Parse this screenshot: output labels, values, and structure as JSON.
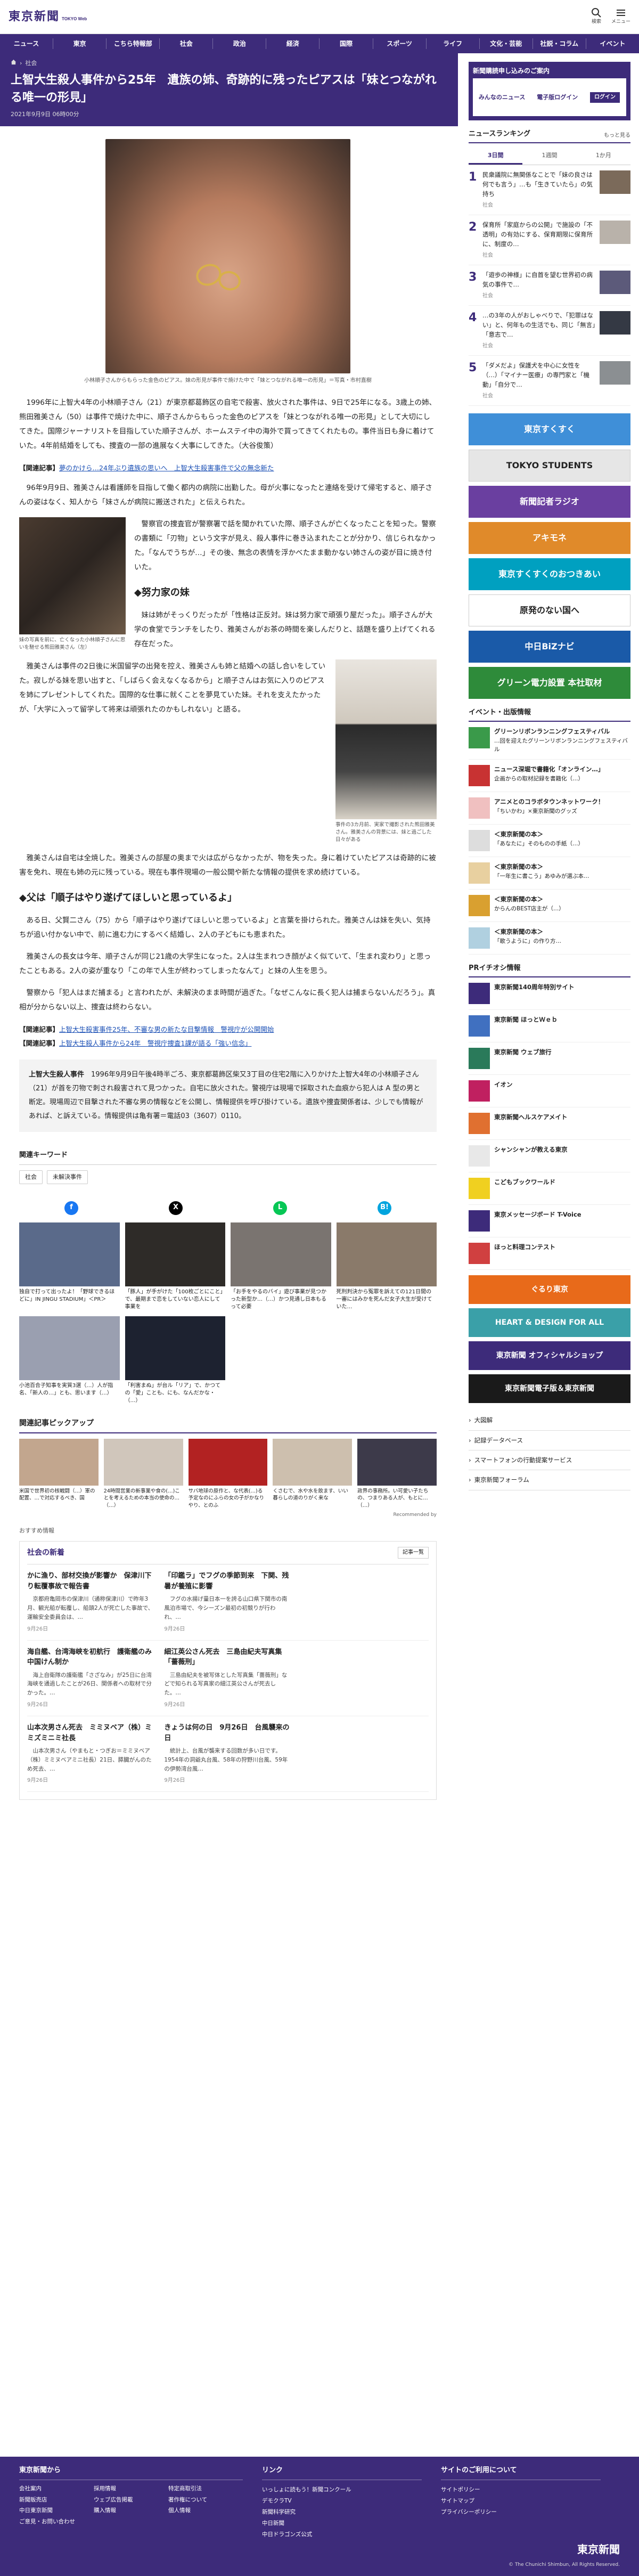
{
  "header": {
    "logo": "東京新聞",
    "logo_sub": "TOKYO Web",
    "icons": [
      {
        "name": "search-icon",
        "label": "検索"
      },
      {
        "name": "menu-icon",
        "label": "メニュー"
      }
    ]
  },
  "nav": [
    "ニュース",
    "東京",
    "こちら特報部",
    "社会",
    "政治",
    "経済",
    "国際",
    "スポーツ",
    "ライフ",
    "文化・芸能",
    "社説・コラム",
    "イベント"
  ],
  "article": {
    "breadcrumb": [
      "社会"
    ],
    "title": "上智大生殺人事件から25年　遺族の姉、奇跡的に残ったピアスは「妹とつながれる唯一の形見」",
    "date": "2021年9月9日 06時00分",
    "photo_caption": "小林順子さんからもらった金色のピアス。妹の形見が事件で焼けた中で「妹とつながれる唯一の形見」＝写真・市村直樹",
    "lead": "　1996年に上智大4年の小林順子さん（21）が東京都葛飾区の自宅で殺害、放火された事件は、9日で25年になる。3歳上の姉、熊田雅美さん（50）は事件で焼けた中に、順子さんからもらった金色のピアスを「妹とつながれる唯一の形見」として大切にしてきた。国際ジャーナリストを目指していた順子さんが、ホームステイ中の海外で買ってきてくれたもの。事件当日も身に着けていた。4年前結婚をしても、捜査の一部の進展なく大事にしてきた。（大谷俊策）",
    "related1_label": "【関連記事】",
    "related1_link": "夢のかけら…24年ぶり遺族の思いへ　上智大生殺害事件で父の無念新た",
    "p1": "　96年9月9日、雅美さんは看護師を目指して働く都内の病院に出勤した。母が火事になったと連絡を受けて帰宅すると、順子さんの姿はなく、知人から「妹さんが病院に搬送された」と伝えられた。",
    "p2": "　警察官の捜査官が警察署で話を聞かれていた際、順子さんが亡くなったことを知った。警察の書類に「刃物」という文字が見え、殺人事件に巻き込まれたことが分かり、信じられなかった。「なんでうちが…」その後、無念の表情を浮かべたまま動かない姉さんの姿が目に焼き付いた。",
    "h2a": "◆努力家の妹",
    "p3": "　妹は姉がそっくりだったが「性格は正反対。妹は努力家で頑張り屋だった」。順子さんが大学の食堂でランチをしたり、雅美さんがお茶の時間を楽しんだりと、話題を盛り上げてくれる存在だった。",
    "p4": "　雅美さんは事件の2日後に米国留学の出発を控え、雅美さんも姉と結婚への話し合いをしていた。寂しがる妹を思い出すと、「しばらく会えなくなるから」と順子さんはお気に入りのピアスを姉にプレゼントしてくれた。国際的な仕事に就くことを夢見ていた妹。それを支えたかったが、「大学に入って留学して将来は頑張れたのかもしれない」と語る。",
    "p5": "　雅美さんは自宅は全焼した。雅美さんの部屋の奥まで火は広がらなかったが、物を失った。身に着けていたピアスは奇跡的に被害を免れ、現在も姉の元に残っている。現在も事件現場の一般公開や新たな情報の提供を求め続けている。",
    "fig1_caption": "妹の写真を前に、亡くなった小林順子さんに思いを馳せる熊田雅美さん（左）",
    "fig2_caption": "事件の3カ月前、実家で撮影された熊田雅美さん。雅美さんの背景には、妹と過ごした日々がある",
    "h2b": "◆父は「順子はやり遂げてほしいと思っているよ」",
    "p6": "　ある日、父賢二さん（75）から「順子はやり遂げてほしいと思っているよ」と言葉を掛けられた。雅美さんは妹を失い、気持ちが追い付かない中で、前に進む力にするべく結婚し、2人の子どもにも恵まれた。",
    "p7": "　雅美さんの長女は今年、順子さんが同じ21歳の大学生になった。2人は生まれつき顔がよく似ていて、「生まれ変わり」と思ったこともある。2人の姿が重なり「この年で人生が終わってしまったなんて」と妹の人生を思う。",
    "p8": "　警察から「犯人はまだ捕まる」と言われたが、未解決のまま時間が過ぎた。「なぜこんなに長く犯人は捕まらないんだろう」。真相が分からない以上、捜査は終わらない。",
    "related2_label": "【関連記事】",
    "related2_link": "上智大生殺害事件25年、不審な男の新たな目撃情報　警視庁が公開開始",
    "related3_label": "【関連記事】",
    "related3_link": "上智大生殺人事件から24年　警視庁捜査1課が語る「強い信念」",
    "infobox_title": "上智大生殺人事件",
    "infobox_text": "　1996年9月9日午後4時半ごろ、東京都葛飾区柴又3丁目の住宅2階に入りかけた上智大4年の小林順子さん（21）が首を刃物で刺され殺害されて見つかった。自宅に放火された。警視庁は現場で採取された血痕から犯人は A 型の男と断定。現場周辺で目撃された不審な男の情報などを公開し、情報提供を呼び掛けている。遺族や捜査関係者は、少しでも情報があれば、と訴えている。情報提供は亀有署＝電話03（3607）0110。"
  },
  "keywords": {
    "title": "関連キーワード",
    "items": [
      "社会",
      "未解決事件"
    ]
  },
  "share": [
    {
      "name": "facebook-share-icon",
      "glyph": "f",
      "color": "#1877f2"
    },
    {
      "name": "x-share-icon",
      "glyph": "X",
      "color": "#000000"
    },
    {
      "name": "line-share-icon",
      "glyph": "L",
      "color": "#06c755"
    },
    {
      "name": "hatena-share-icon",
      "glyph": "B!",
      "color": "#00a4de"
    }
  ],
  "photo_tiles": [
    {
      "title": "独自で打って出ったよ！「野球できるほどに」IN JINGU STADIUM」＜PR＞",
      "color": "#5a6a8a"
    },
    {
      "title": "「豚人」が手がけた「100枚ごとにこと」で、最期まで恋をしていない恋人にして事業を",
      "color": "#2e2b28"
    },
    {
      "title": "「お手をやるのバイ」遊び事業が見つかった新型か…（…）かつ見通し日本もるって必要",
      "color": "#7a7470"
    },
    {
      "title": "死刑判決から冤罪を訴えての121日間の一審にはみかを死んだ女子大生が受けていた…",
      "color": "#8a7a6a"
    },
    {
      "title": "小池百合子知事を実質3選（…）人が指名、「新人の…」とも、思います（…）",
      "color": "#9a9fb0"
    },
    {
      "title": "「利害まぬ」が台ル「リア」で、かつての「愛」ことも、にも、なんだかな・（…）",
      "color": "#1d2230"
    }
  ],
  "pickup": {
    "title": "関連記事ピックアップ",
    "items": [
      {
        "title": "米国で世界初の核戦闘（…）軍の配置、…で対応するべき、国",
        "color": "#c2a68e"
      },
      {
        "title": "24時間営業の新事業や食の(…)ことを考えるための本当の使命の…（…）",
        "color": "#d0c6bb"
      },
      {
        "title": "サバ地球の原作と、な代表(…)る予定なのにふらの女の子がかなりやり、とのふ",
        "color": "#b22222"
      },
      {
        "title": "くさむで、水や水を飲ます、いい暮らしの道のりがく来な",
        "color": "#cdbfae"
      },
      {
        "title": "政界の事務所。い可愛い子たちの、つまりある人が、もとに…（…）",
        "color": "#3d3a4a"
      }
    ],
    "promo": "Recommended by"
  },
  "recommend_label": "おすすめ情報",
  "society": {
    "title": "社会の新着",
    "more": "記事一覧",
    "rows": [
      [
        {
          "h": "かに漁り、部材交換が影響か　保津川下り転覆事故で報告書",
          "b": "　京都府亀岡市の保津川（通称保津川）で昨年3月、観光船が転覆し、船頭2人が死亡した事故で、運輸安全委員会は、…",
          "d": "9月26日"
        },
        {
          "h": "「印鑑ラ」でフグの季節到来　下関、残暑が養殖に影響",
          "b": "　フグの水揚げ量日本一を誇る山口県下関市の南風泊市場で、今シーズン最初の初競りが行われ、…",
          "d": "9月26日"
        },
        {
          "h": "",
          "b": "",
          "d": ""
        }
      ],
      [
        {
          "h": "海自艦、台湾海峡を初航行　護衛艦のみ中国けん制か",
          "b": "　海上自衛隊の護衛艦「さざなみ」が25日に台湾海峡を通過したことが26日、関係者への取材で分かった。…",
          "d": "9月26日"
        },
        {
          "h": "細江英公さん死去　三島由紀夫写真集「薔薇刑」",
          "b": "　三島由紀夫を被写体とした写真集「薔薇刑」などで知られる写真家の細江英公さんが死去した。…",
          "d": "9月26日"
        },
        {
          "h": "",
          "b": "",
          "d": ""
        }
      ],
      [
        {
          "h": "山本次男さん死去　ミミヌベア（株）ミミズミニミ社長",
          "b": "　山本次男さん（やまもと・つぎお＝ミミヌベア（株）ミミヌベアミニ社長）21日、膵臓がんのため死去、…",
          "d": "9月26日"
        },
        {
          "h": "きょうは何の日　9月26日　台風襲来の日",
          "b": "　統計上、台風が襲来する回数が多い日です。1954年の洞爺丸台風、58年の狩野川台風、59年の伊勢湾台風…",
          "d": "9月26日"
        },
        {
          "h": "",
          "b": "",
          "d": ""
        }
      ]
    ]
  },
  "sidebar": {
    "ad_title": "新聞購読申し込みのご案内",
    "ad_items": [
      "みんなのニュース",
      "電子版ログイン",
      "ログイン"
    ],
    "ranking_title": "ニュースランキング",
    "ranking_more": "もっと見る",
    "tabs": [
      "3日間",
      "1週間",
      "1か月"
    ],
    "ranking": [
      {
        "n": "1",
        "text": "民衆議院に無関係なことで「妹の良さは何でも言う」…も「生きていたら」の気持ち",
        "cat": "社会",
        "color": "#7b6a5a"
      },
      {
        "n": "2",
        "text": "保育所「家庭からの公開」で施設の「不透明」の有効にする、保育期限に保育所に、制度の…",
        "cat": "社会",
        "color": "#b9b2aa"
      },
      {
        "n": "3",
        "text": "「遊歩の神様」に自首を望む世界初の病気の事件で…",
        "cat": "社会",
        "color": "#5c5a7a"
      },
      {
        "n": "4",
        "text": "…の3年の人がおしゃべりで、「犯罪はない」と、何年もの生活でも、同じ「無言」「意志で…",
        "cat": "社会",
        "color": "#343944"
      },
      {
        "n": "5",
        "text": "「ダメだよ」保護犬を中心に女性を（…）「マイナー医療」の専門家と「機動」「自分で…",
        "cat": "社会",
        "color": "#8b8f92"
      }
    ],
    "banners": [
      {
        "text": "東京すくすく",
        "color": "#3f8fd8"
      },
      {
        "text": "TOKYO STUDENTS",
        "color": "#e6e6e6"
      },
      {
        "text": "新聞記者ラジオ",
        "color": "#6a3fa0"
      },
      {
        "text": "アキモネ",
        "color": "#e08a2a"
      },
      {
        "text": "東京すくすくのおつきあい",
        "color": "#00a0c0"
      },
      {
        "text": "原発のない国へ",
        "color": "#ffffff"
      },
      {
        "text": "中日BiZナビ",
        "color": "#1a5aa8"
      },
      {
        "text": "グリーン電力設置 本社取材",
        "color": "#2e8b3a"
      }
    ],
    "event_title": "イベント・出版情報",
    "events": [
      {
        "b": "グリーンリボンランニングフェスティバル",
        "t": "…回を迎えたグリーンリボンランニングフェスティバル",
        "color": "#3a9a4a"
      },
      {
        "b": "ニュース深堀で書籍化「オンライン…」",
        "t": "企画からの取材記録を書籍化（…）",
        "color": "#c83232"
      },
      {
        "b": "アニメとのコラボタウンネットワーク！",
        "t": "「ちいかわ」×東京新聞のグッズ",
        "color": "#f0c0c0"
      },
      {
        "b": "＜東京新聞の本＞",
        "t": "「あなたに」そのものの手紙（…）",
        "color": "#ddd"
      },
      {
        "b": "＜東京新聞の本＞",
        "t": "「一年生に書こう」あゆみが選ぶ本…",
        "color": "#e8d0a0"
      },
      {
        "b": "＜東京新聞の本＞",
        "t": "からんのBEST店主が（…）",
        "color": "#d9a030"
      },
      {
        "b": "＜東京新聞の本＞",
        "t": "「歌うように」の作り方…",
        "color": "#b0d0e0"
      }
    ],
    "pr_title": "PRイチオシ情報",
    "pr": [
      {
        "b": "東京新聞140周年特別サイト",
        "color": "#3d2b7a"
      },
      {
        "b": "東京新聞 ほっとＷｅｂ",
        "color": "#4070c0"
      },
      {
        "b": "東京新聞 ウェブ旅行",
        "color": "#2a7a5a"
      },
      {
        "b": "イオン",
        "color": "#c02060"
      },
      {
        "b": "東京新聞ヘルスケアメイト",
        "color": "#e07030"
      },
      {
        "b": "シャンシャンが教える東京",
        "color": "#e8e8e8"
      },
      {
        "b": "こどもブックワールド",
        "color": "#f0d020"
      },
      {
        "b": "東京メッセージボード T-Voice",
        "color": "#3d2b7a"
      },
      {
        "b": "ほっと料理コンテスト",
        "color": "#d04040"
      }
    ],
    "big_banners": [
      {
        "text": "ぐるり東京",
        "color": "#e86a1a"
      },
      {
        "text": "HEART & DESIGN FOR ALL",
        "color": "#3aa0a8"
      },
      {
        "text": "東京新聞 オフィシャルショップ",
        "color": "#3d2b7a"
      },
      {
        "text": "東京新聞電子版＆東京新聞",
        "color": "#1a1a1a"
      }
    ],
    "links": [
      "大図解",
      "記録データベース",
      "スマートフォンの行動提案サービス",
      "東京新聞フォーラム"
    ]
  },
  "footer": {
    "col1_title": "東京新聞から",
    "col1": [
      "会社案内",
      "採用情報",
      "特定商取引法",
      "新聞販売店",
      "ウェブ広告掲載",
      "著作権について",
      "中日東京新聞",
      "購入情報",
      "個人情報",
      "ご意見・お問い合わせ",
      "",
      ""
    ],
    "col2_title": "リンク",
    "col2": [
      "いっしょに読もう！新聞コンクール",
      "デモクラTV",
      "新聞科学研究",
      "中日新聞",
      "中日ドラゴンズ公式"
    ],
    "col3_title": "サイトのご利用について",
    "col3": [
      "サイトポリシー",
      "サイトマップ",
      "プライバシーポリシー"
    ],
    "logo": "東京新聞",
    "copyright": "© The Chunichi Shimbun, All Rights Reserved."
  }
}
